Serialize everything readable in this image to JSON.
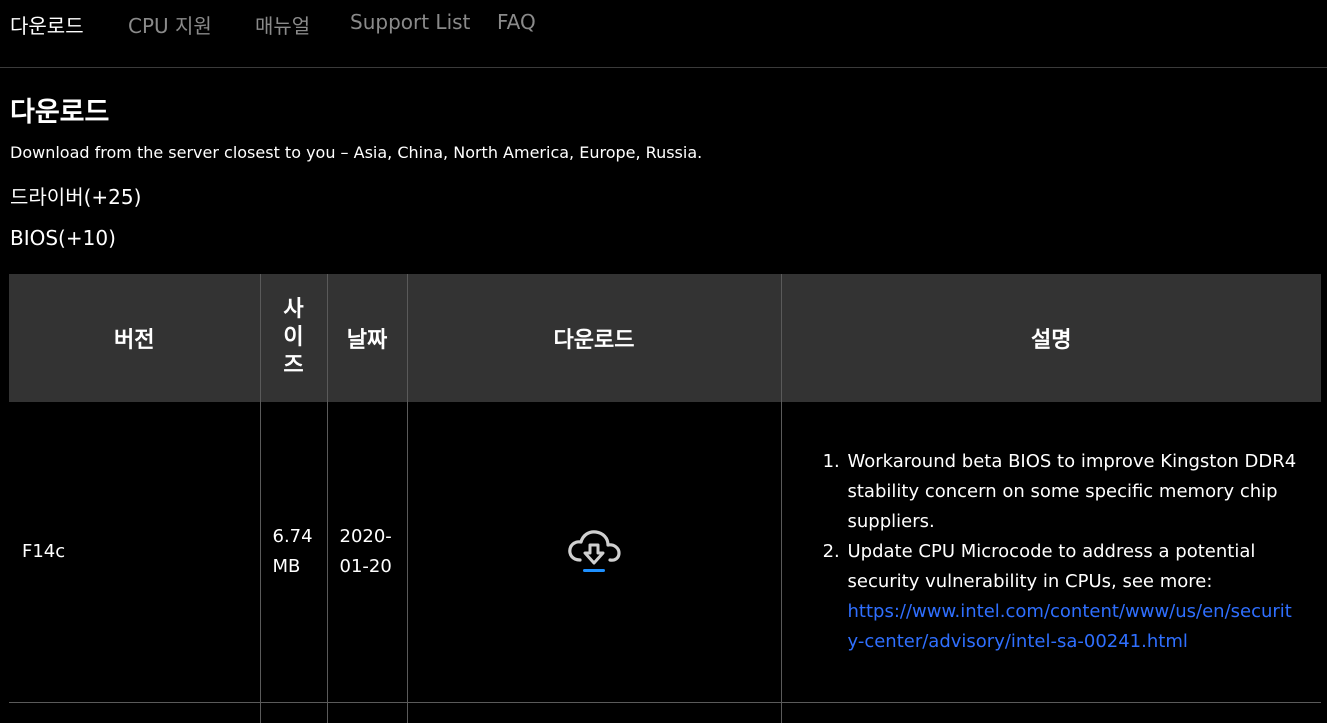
{
  "nav": {
    "items": [
      {
        "label": "다운로드",
        "active": true
      },
      {
        "label": "CPU 지원",
        "active": false
      },
      {
        "label": "매뉴얼",
        "active": false
      },
      {
        "label": "Support List",
        "active": false
      },
      {
        "label": "FAQ",
        "active": false
      }
    ]
  },
  "main": {
    "title": "다운로드",
    "description": "Download from the server closest to you – Asia, China, North America, Europe, Russia.",
    "sections": {
      "drivers": "드라이버(+25)",
      "bios": "BIOS(+10)"
    }
  },
  "table": {
    "headers": {
      "version": "버전",
      "size": "사이즈",
      "date": "날짜",
      "download": "다운로드",
      "description": "설명"
    },
    "rows": [
      {
        "version": "F14c",
        "size": "6.74 MB",
        "date": "2020-01-20",
        "download_icon": "cloud-download-icon",
        "notes": [
          "Workaround beta BIOS to improve Kingston DDR4 stability concern on some specific memory chip suppliers.",
          "Update CPU Microcode to address a potential security vulnerability in CPUs, see more:"
        ],
        "notes_link": "https://www.intel.com/content/www/us/en/security-center/advisory/intel-sa-00241.html"
      }
    ]
  },
  "colors": {
    "background": "#000000",
    "header_background": "#333333",
    "link": "#2f6fff",
    "icon_accent": "#1e90ff",
    "inactive_nav": "#8a8a8a"
  }
}
